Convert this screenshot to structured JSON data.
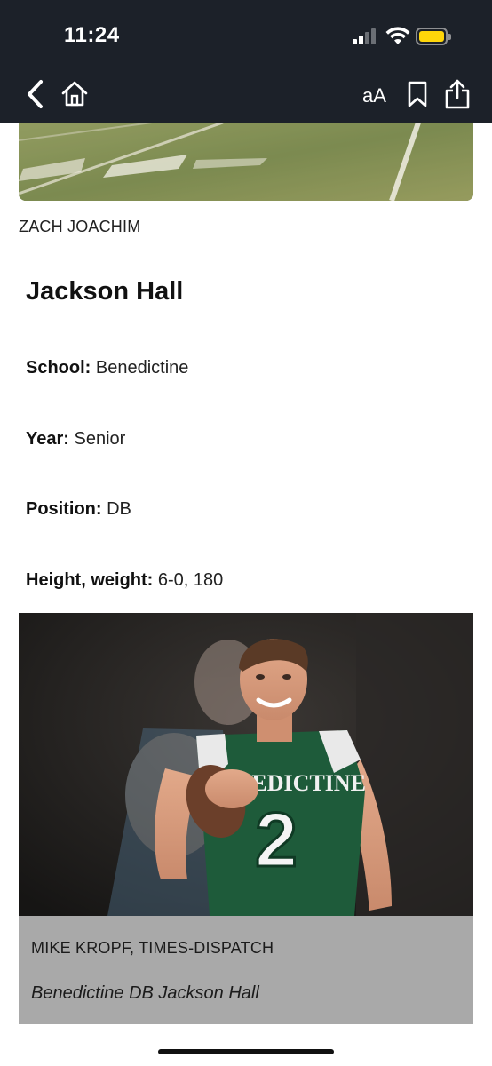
{
  "status_bar": {
    "time": "11:24",
    "battery_color": "#ffd60a"
  },
  "toolbar": {
    "back_icon": "chevron-left-icon",
    "home_icon": "home-icon",
    "text_size_label": "aA",
    "bookmark_icon": "bookmark-icon",
    "share_icon": "share-icon"
  },
  "article": {
    "hero_credit": "ZACH JOACHIM",
    "player_name": "Jackson Hall",
    "facts": [
      {
        "label": "School:",
        "value": " Benedictine"
      },
      {
        "label": "Year:",
        "value": " Senior"
      },
      {
        "label": "Position:",
        "value": " DB"
      },
      {
        "label": "Height, weight:",
        "value": " 6-0, 180"
      }
    ],
    "photo": {
      "jersey_text": "BENEDICTINE",
      "jersey_number": "2",
      "credit": "MIKE KROPF, TIMES-DISPATCH",
      "caption": "Benedictine DB Jackson Hall"
    }
  },
  "colors": {
    "topbar_bg": "#1c2129",
    "jersey_green": "#1e5b3a",
    "caption_bg": "#a9a9a9"
  }
}
